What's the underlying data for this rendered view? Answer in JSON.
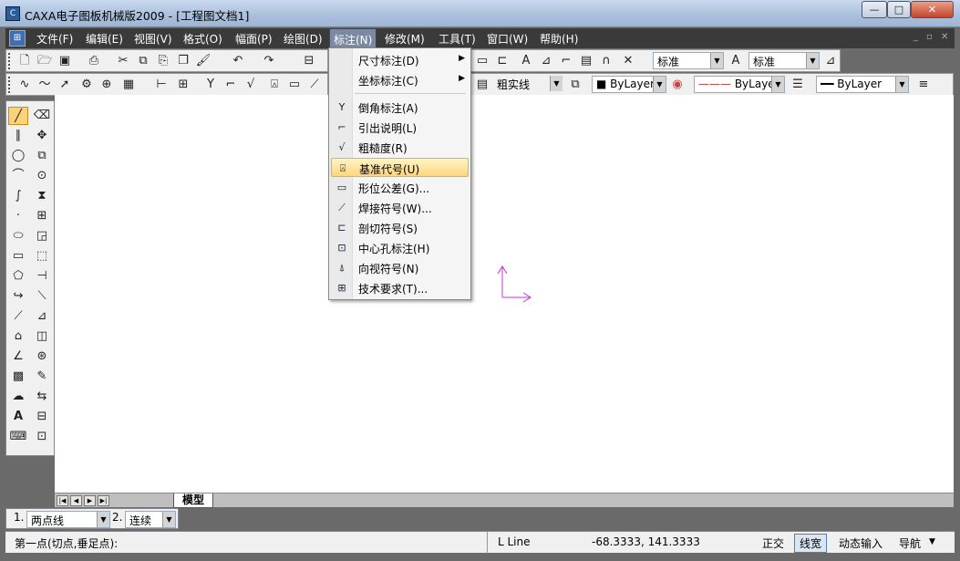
{
  "window": {
    "title": "CAXA电子图板机械版2009 - [工程图文档1]",
    "icon": "caxa-app-icon",
    "minimize": "—",
    "maximize": "□",
    "close": "✕"
  },
  "menubar": {
    "items": [
      "文件(F)",
      "编辑(E)",
      "视图(V)",
      "格式(O)",
      "幅面(P)",
      "绘图(D)",
      "标注(N)",
      "修改(M)",
      "工具(T)",
      "窗口(W)",
      "帮助(H)"
    ],
    "active": "标注(N)",
    "mdi_controls": [
      "_",
      "▫",
      "✕"
    ]
  },
  "toolbar": {
    "text_style": "标准",
    "dim_style": "标准",
    "linetype_name": "粗实线",
    "layer_color": "ByLayer",
    "linetype": "ByLayer",
    "lineweight": "ByLayer"
  },
  "dropdown": {
    "items": [
      {
        "label": "尺寸标注(D)",
        "icon": "",
        "submenu": true
      },
      {
        "label": "坐标标注(C)",
        "icon": "",
        "submenu": true
      },
      {
        "label": "倒角标注(A)",
        "icon": "chamfer-dim-icon",
        "submenu": false
      },
      {
        "label": "引出说明(L)",
        "icon": "leader-note-icon",
        "submenu": false
      },
      {
        "label": "粗糙度(R)",
        "icon": "roughness-icon",
        "submenu": false
      },
      {
        "label": "基准代号(U)",
        "icon": "datum-symbol-icon",
        "submenu": false,
        "highlighted": true
      },
      {
        "label": "形位公差(G)...",
        "icon": "geometric-tolerance-icon",
        "submenu": false
      },
      {
        "label": "焊接符号(W)...",
        "icon": "weld-symbol-icon",
        "submenu": false
      },
      {
        "label": "剖切符号(S)",
        "icon": "section-symbol-icon",
        "submenu": false
      },
      {
        "label": "中心孔标注(H)",
        "icon": "center-hole-icon",
        "submenu": false
      },
      {
        "label": "向视符号(N)",
        "icon": "view-direction-icon",
        "submenu": false
      },
      {
        "label": "技术要求(T)...",
        "icon": "tech-requirement-icon",
        "submenu": false
      }
    ]
  },
  "layout_tabs": {
    "model": "模型"
  },
  "command_bar": {
    "option1_num": "1.",
    "option1_value": "两点线",
    "option2_num": "2.",
    "option2_value": "连续"
  },
  "status": {
    "prompt": "第一点(切点,垂足点):",
    "command": "L Line",
    "coordinates": "-68.3333, 141.3333",
    "ortho": "正交",
    "lineweight": "线宽",
    "dynamic_input": "动态输入",
    "navigation": "导航"
  },
  "colors": {
    "ucs_axis": "#cc33cc",
    "highlight": "#fbd77e",
    "menubar_bg": "#3a3a3a"
  }
}
